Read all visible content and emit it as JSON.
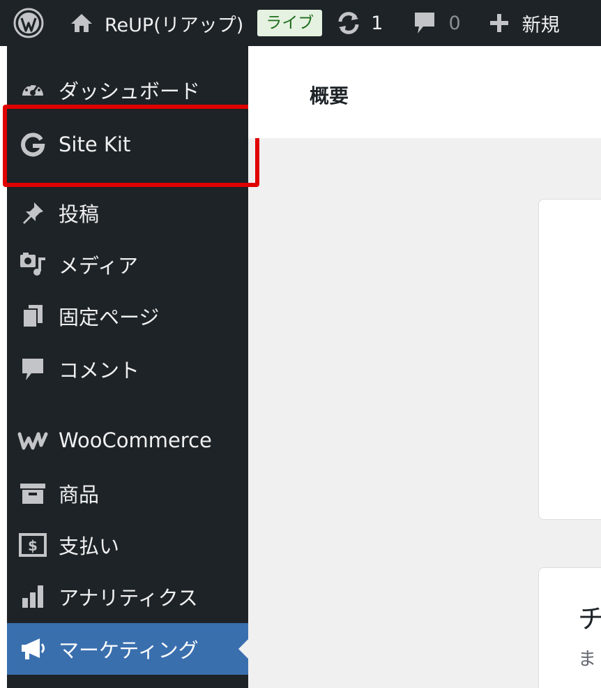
{
  "adminbar": {
    "site_name": "ReUP(リアップ)",
    "live_badge": "ライブ",
    "updates_count": "1",
    "comments_count": "0",
    "new_label": "新規"
  },
  "sidebar": {
    "items": [
      {
        "label": "ダッシュボード",
        "icon": "dashboard-icon"
      },
      {
        "label": "Site Kit",
        "icon": "google-g-icon"
      },
      {
        "label": "投稿",
        "icon": "pin-icon"
      },
      {
        "label": "メディア",
        "icon": "media-icon"
      },
      {
        "label": "固定ページ",
        "icon": "pages-icon"
      },
      {
        "label": "コメント",
        "icon": "comment-icon"
      },
      {
        "label": "WooCommerce",
        "icon": "woocommerce-icon"
      },
      {
        "label": "商品",
        "icon": "archive-icon"
      },
      {
        "label": "支払い",
        "icon": "payments-icon"
      },
      {
        "label": "アナリティクス",
        "icon": "bar-chart-icon"
      },
      {
        "label": "マーケティング",
        "icon": "megaphone-icon",
        "active": true
      }
    ]
  },
  "content": {
    "title": "概要",
    "card2_heading": "チ",
    "card2_sub": "ま"
  },
  "colors": {
    "adminbar_bg": "#1d2327",
    "active_item": "#3a6fae",
    "highlight": "#e00000",
    "live_badge_bg": "#e6f2e1"
  }
}
